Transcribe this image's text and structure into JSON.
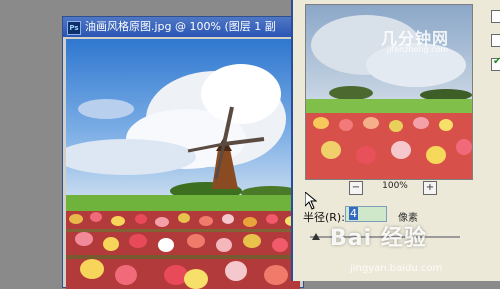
{
  "document": {
    "title": "油画风格原图.jpg @ 100% (图层 1 副"
  },
  "filter_dialog": {
    "zoom": {
      "minus": "−",
      "value": "100%",
      "plus": "+"
    },
    "radius": {
      "label": "半径(R):",
      "value": "4",
      "unit": "像素",
      "slider_fraction": 0.02
    },
    "options": [
      {
        "checked": false
      },
      {
        "checked": false
      },
      {
        "checked": true
      }
    ]
  },
  "watermarks": {
    "logo": "几分钟网",
    "logo_url": "jifenzhong.com",
    "baidu": "Bai 经验",
    "baidu_url": "jingyan.baidu.com"
  }
}
